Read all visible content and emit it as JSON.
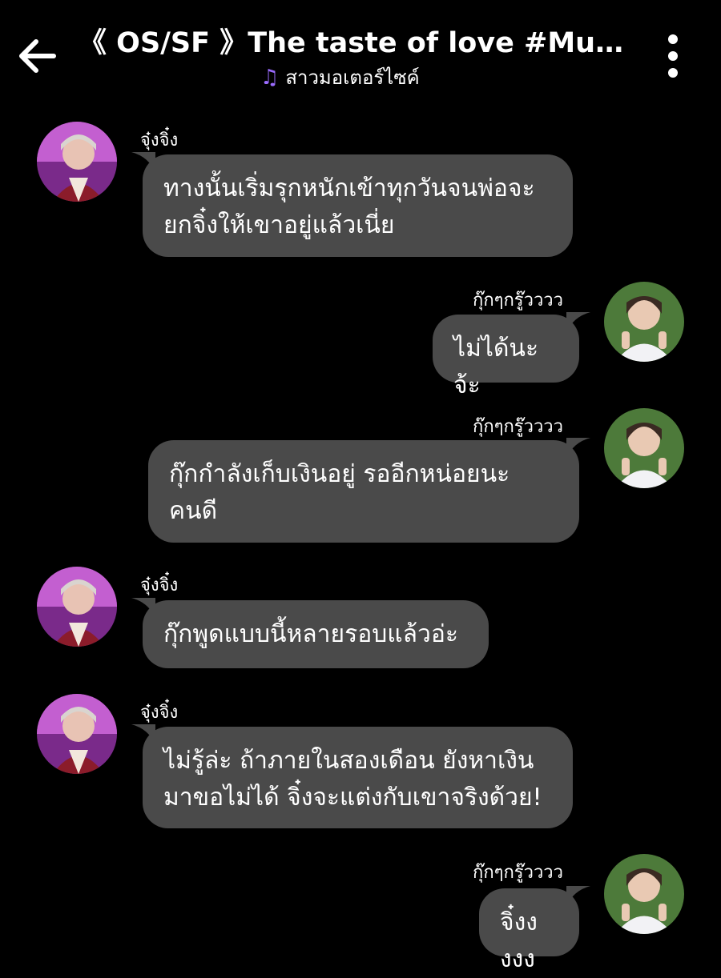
{
  "header": {
    "title": "《 OS/SF 》The taste of love #MusicLov...",
    "subtitle": "สาวมอเตอร์ไซค์",
    "subtitle_icon": "music-note-icon",
    "back_icon": "arrow-left-icon",
    "menu_icon": "more-vertical-icon"
  },
  "colors": {
    "background": "#000000",
    "bubble": "#4a4a4a",
    "accent": "#9b6cff"
  },
  "messages": [
    {
      "sender": "จุ๋งจิ๋ง",
      "side": "left",
      "lines": [
        "ทางนั้นเริ่มรุกหนักเข้าทุกวันจนพ่อจะ",
        "ยกจิ๋งให้เขาอยู่แล้วเนี่ย"
      ]
    },
    {
      "sender": "กุ๊กๆกรู๊วววว",
      "side": "right",
      "lines": [
        "ไม่ได้นะจ้ะ"
      ]
    },
    {
      "sender": "กุ๊กๆกรู๊วววว",
      "side": "right",
      "lines": [
        "กุ๊กกำลังเก็บเงินอยู่ รออีกหน่อยนะ",
        "คนดี"
      ]
    },
    {
      "sender": "จุ๋งจิ๋ง",
      "side": "left",
      "lines": [
        "กุ๊กพูดแบบนี้หลายรอบแล้วอ่ะ"
      ]
    },
    {
      "sender": "จุ๋งจิ๋ง",
      "side": "left",
      "lines": [
        "ไม่รู้ล่ะ ถ้าภายในสองเดือน ยังหาเงิน",
        "มาขอไม่ได้ จิ๋งจะแต่งกับเขาจริงด้วย!"
      ]
    },
    {
      "sender": "กุ๊กๆกรู๊วววว",
      "side": "right",
      "lines": [
        "จิ๋งงงงง"
      ]
    }
  ]
}
